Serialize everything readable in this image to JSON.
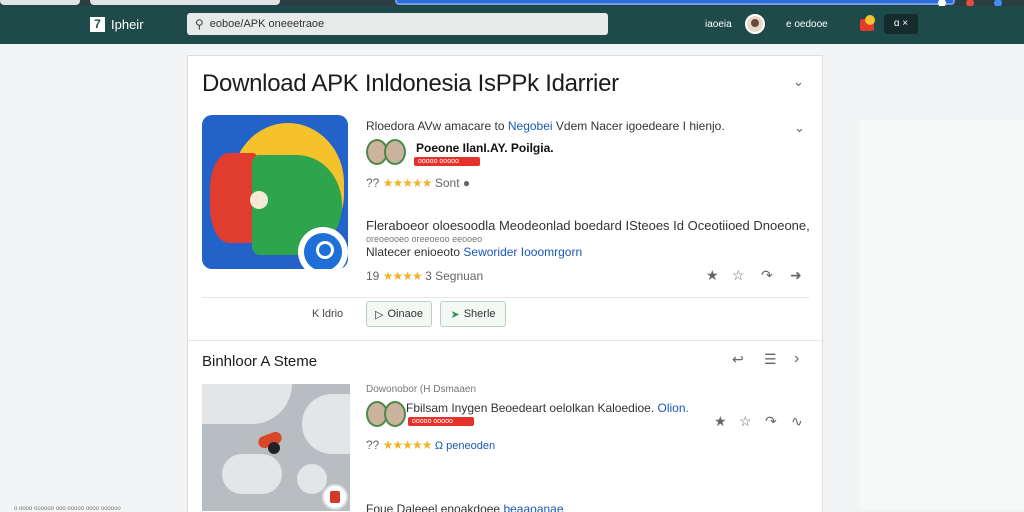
{
  "topbar": {
    "logo_text": "Ipheir",
    "search_value": "eoboe/APK oneeetraoe",
    "link_right": "iaoeia",
    "link_right2": "e oedooe",
    "dark_button": "ɑ  ×"
  },
  "card": {
    "title": "Download APK Inldonesia IsPPk Idarrier",
    "meta_line_a": "Rloedora AVw amacare to",
    "meta_line_blue": "Negobei",
    "meta_line_b": "Vdem Nacer igoedeare I hienjo.",
    "developer_name": "Poeone IlanI.AY. Poilgia.",
    "developer_badge": "ooooo ooooo oooo",
    "rating_prefix": "??",
    "rating_stars": "★★★★★",
    "rating_suffix": "Sont",
    "desc_line1": "Fleraboeor oloesoodla Meodeonlad boedard ISteoes Id Oceotiioed Dnoeone,",
    "desc_line2": "oreoeooeo oreeoeoo eeooeo",
    "desc_line3_a": "Nlatecer enioeoto",
    "desc_line3_blue": "Seworider Iooomrgorn",
    "rating2_prefix": "19",
    "rating2_stars": "★★★★",
    "rating2_suffix": "3 Segnuan",
    "button_label": "K ldrio",
    "btn_primary": "Oinaoe",
    "btn_share": "Sherle"
  },
  "section": {
    "title": "Binhloor A Steme",
    "item_header": "Dowonobor (H Dsmaaen",
    "item_title": "Fbilsam Inygen Beoedeart oelolkan Kaloedioe.",
    "item_title_blue": "Olion.",
    "item_badge": "ooooo ooooo oooo",
    "item_rating_prefix": "??",
    "item_rating_stars": "★★★★★",
    "item_rating_link": "Ω peneoden",
    "item_bottom_a": "Foue Daleeel enoakdoee",
    "item_bottom_blue": "beaaoanae"
  },
  "footer": {
    "text": "o oooo oooooo ooo ooooo oooo oooooo"
  },
  "colors": {
    "topbar": "#1f4a4a",
    "accent_blue": "#1a56b8",
    "star": "#f0b32a",
    "share_green": "#2a9b4a"
  }
}
